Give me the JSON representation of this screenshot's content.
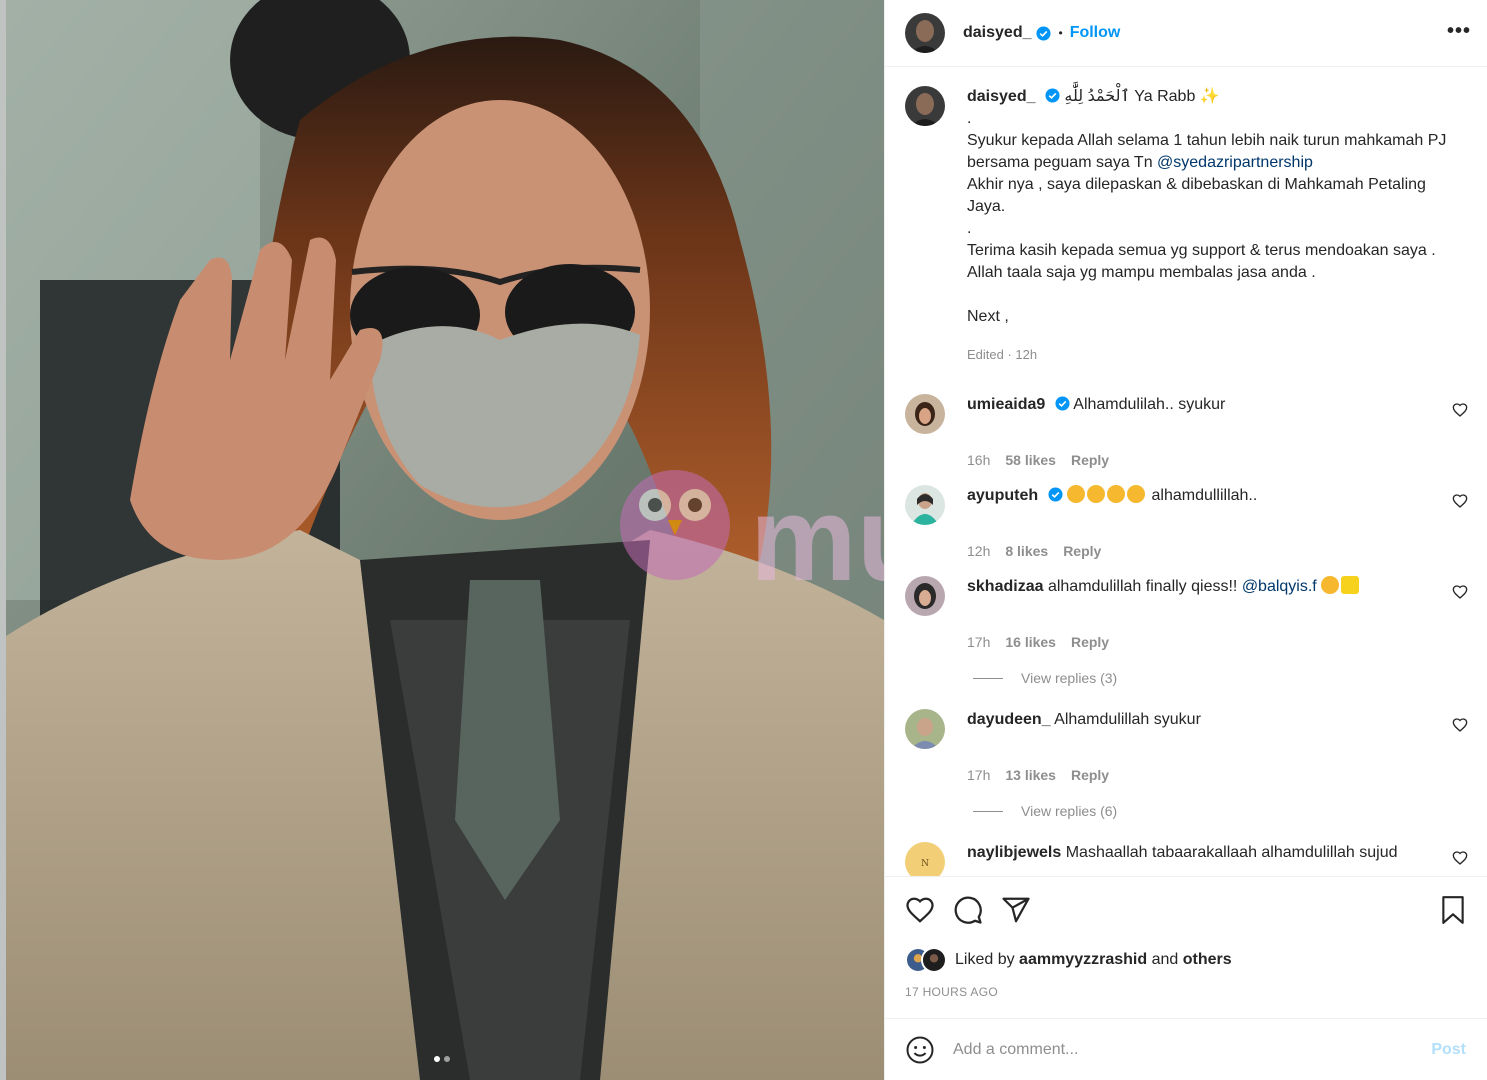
{
  "header": {
    "username": "daisyed_",
    "separator": "•",
    "follow_label": "Follow",
    "more_label": "•••"
  },
  "caption": {
    "username": "daisyed_",
    "line1": "ٱلْحَمْدُ لِلَّٰهِ Ya Rabb ✨",
    "dot1": ".",
    "para1_a": "Syukur kepada Allah selama 1 tahun lebih naik turun mahkamah PJ bersama peguam saya Tn ",
    "para1_mention": "@syedazripartnership",
    "para1_b": "Akhir nya , saya dilepaskan & dibebaskan di Mahkamah Petaling Jaya.",
    "dot2": ".",
    "para2": "Terima kasih kepada semua yg support & terus mendoakan saya . Allah taala saja yg mampu membalas jasa anda .",
    "para3": "Next ,",
    "meta": "Edited · 12h"
  },
  "comments": [
    {
      "username": "umieaida9",
      "text": "Alhamdulilah.. syukur",
      "time": "16h",
      "likes": "58 likes",
      "reply": "Reply"
    },
    {
      "username": "ayuputeh",
      "text": "alhamdullillah..",
      "time": "12h",
      "likes": "8 likes",
      "reply": "Reply"
    },
    {
      "username": "skhadizaa",
      "text": "alhamdulillah finally qiess!! ",
      "mention": "@balqyis.f",
      "time": "17h",
      "likes": "16 likes",
      "reply": "Reply",
      "view_replies": "View replies (3)"
    },
    {
      "username": "dayudeen_",
      "text": "Alhamdulillah syukur",
      "time": "17h",
      "likes": "13 likes",
      "reply": "Reply",
      "view_replies": "View replies (6)"
    },
    {
      "username": "naylibjewels",
      "text": "Mashaallah tabaarakallaah alhamdulillah sujud"
    }
  ],
  "liked": {
    "prefix": "Liked by",
    "user": "aammyyzzrashid",
    "and": "and",
    "others": "others"
  },
  "timestamp": "17 HOURS AGO",
  "add_comment": {
    "placeholder": "Add a comment...",
    "post_label": "Post"
  },
  "watermark": "murai",
  "colors": {
    "link": "#0095f6",
    "mention": "#00376b",
    "muted": "#8e8e8e",
    "post_disabled": "#b2dffc"
  },
  "icons": [
    "verified-badge-icon",
    "heart-icon",
    "comment-icon",
    "share-icon",
    "bookmark-icon",
    "emoji-icon",
    "more-icon"
  ]
}
